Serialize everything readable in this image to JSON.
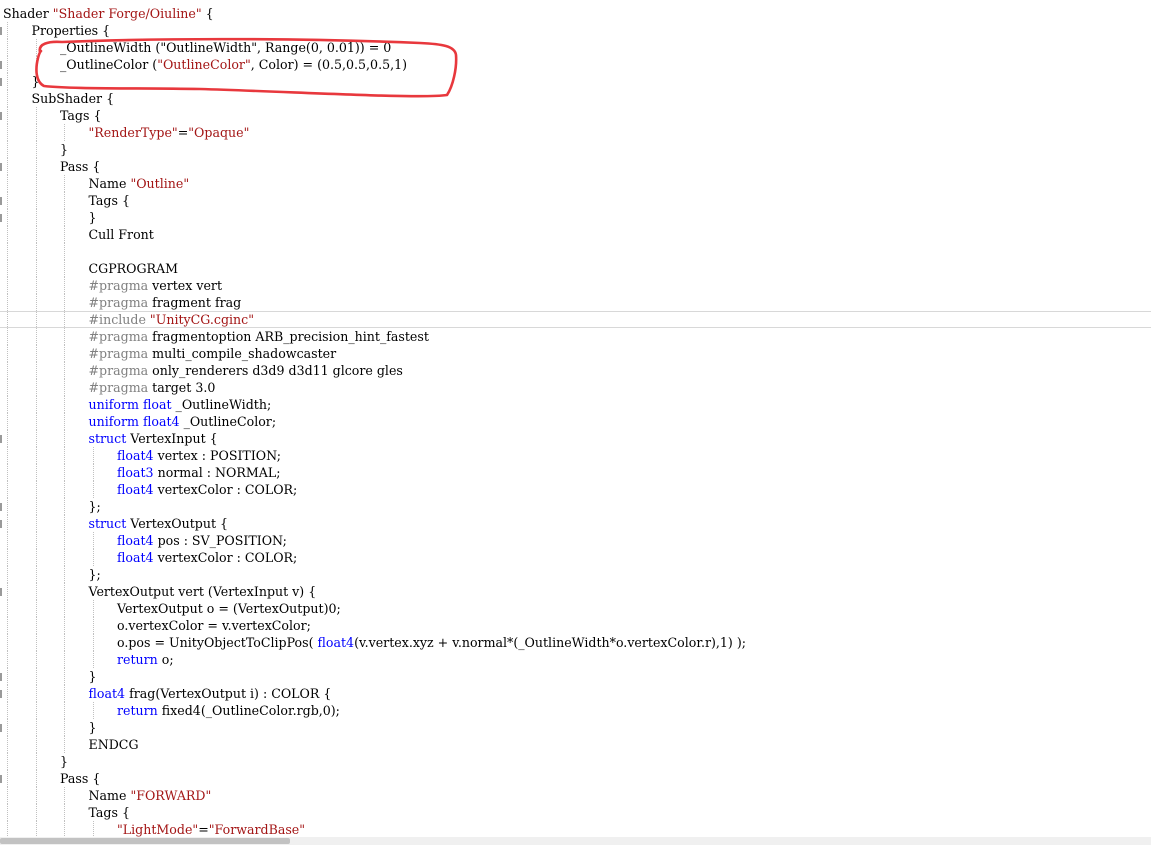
{
  "editor": {
    "current_line": 19,
    "lines": [
      {
        "indent": 0,
        "tokens": [
          [
            "plain",
            "Shader "
          ],
          [
            "str",
            "\"Shader Forge/Oiuline\""
          ],
          [
            "plain",
            " {"
          ]
        ]
      },
      {
        "indent": 1,
        "tokens": [
          [
            "plain",
            "Properties {"
          ]
        ]
      },
      {
        "indent": 2,
        "tokens": [
          [
            "plain",
            "_OutlineWidth (\"OutlineWidth\", Range(0, 0.01)) = 0"
          ]
        ]
      },
      {
        "indent": 2,
        "tokens": [
          [
            "plain",
            "_OutlineColor ("
          ],
          [
            "str",
            "\"OutlineColor\""
          ],
          [
            "plain",
            ", Color) = (0.5,0.5,0.5,1)"
          ]
        ]
      },
      {
        "indent": 1,
        "tokens": [
          [
            "plain",
            "}"
          ]
        ]
      },
      {
        "indent": 1,
        "tokens": [
          [
            "plain",
            "SubShader {"
          ]
        ]
      },
      {
        "indent": 2,
        "tokens": [
          [
            "plain",
            "Tags {"
          ]
        ]
      },
      {
        "indent": 3,
        "tokens": [
          [
            "str",
            "\"RenderType\""
          ],
          [
            "plain",
            "="
          ],
          [
            "str",
            "\"Opaque\""
          ]
        ]
      },
      {
        "indent": 2,
        "tokens": [
          [
            "plain",
            "}"
          ]
        ]
      },
      {
        "indent": 2,
        "tokens": [
          [
            "plain",
            "Pass {"
          ]
        ]
      },
      {
        "indent": 3,
        "tokens": [
          [
            "plain",
            "Name "
          ],
          [
            "str",
            "\"Outline\""
          ]
        ]
      },
      {
        "indent": 3,
        "tokens": [
          [
            "plain",
            "Tags {"
          ]
        ]
      },
      {
        "indent": 3,
        "tokens": [
          [
            "plain",
            "}"
          ]
        ]
      },
      {
        "indent": 3,
        "tokens": [
          [
            "plain",
            "Cull Front"
          ]
        ]
      },
      {
        "indent": 3,
        "tokens": []
      },
      {
        "indent": 3,
        "tokens": [
          [
            "plain",
            "CGPROGRAM"
          ]
        ]
      },
      {
        "indent": 3,
        "tokens": [
          [
            "pp",
            "#pragma"
          ],
          [
            "plain",
            " vertex vert"
          ]
        ]
      },
      {
        "indent": 3,
        "tokens": [
          [
            "pp",
            "#pragma"
          ],
          [
            "plain",
            " fragment frag"
          ]
        ]
      },
      {
        "indent": 3,
        "tokens": [
          [
            "pp",
            "#include"
          ],
          [
            "plain",
            " "
          ],
          [
            "str",
            "\"UnityCG.cginc\""
          ]
        ]
      },
      {
        "indent": 3,
        "tokens": [
          [
            "pp",
            "#pragma"
          ],
          [
            "plain",
            " fragmentoption ARB_precision_hint_fastest"
          ]
        ]
      },
      {
        "indent": 3,
        "tokens": [
          [
            "pp",
            "#pragma"
          ],
          [
            "plain",
            " multi_compile_shadowcaster"
          ]
        ]
      },
      {
        "indent": 3,
        "tokens": [
          [
            "pp",
            "#pragma"
          ],
          [
            "plain",
            " only_renderers d3d9 d3d11 glcore gles"
          ]
        ]
      },
      {
        "indent": 3,
        "tokens": [
          [
            "pp",
            "#pragma"
          ],
          [
            "plain",
            " target 3.0"
          ]
        ]
      },
      {
        "indent": 3,
        "tokens": [
          [
            "kw",
            "uniform"
          ],
          [
            "plain",
            " "
          ],
          [
            "kw",
            "float"
          ],
          [
            "plain",
            " _OutlineWidth;"
          ]
        ]
      },
      {
        "indent": 3,
        "tokens": [
          [
            "kw",
            "uniform"
          ],
          [
            "plain",
            " "
          ],
          [
            "kw",
            "float4"
          ],
          [
            "plain",
            " _OutlineColor;"
          ]
        ]
      },
      {
        "indent": 3,
        "tokens": [
          [
            "kw",
            "struct"
          ],
          [
            "plain",
            " VertexInput {"
          ]
        ]
      },
      {
        "indent": 4,
        "tokens": [
          [
            "kw",
            "float4"
          ],
          [
            "plain",
            " vertex : POSITION;"
          ]
        ]
      },
      {
        "indent": 4,
        "tokens": [
          [
            "kw",
            "float3"
          ],
          [
            "plain",
            " normal : NORMAL;"
          ]
        ]
      },
      {
        "indent": 4,
        "tokens": [
          [
            "kw",
            "float4"
          ],
          [
            "plain",
            " vertexColor : COLOR;"
          ]
        ]
      },
      {
        "indent": 3,
        "tokens": [
          [
            "plain",
            "};"
          ]
        ]
      },
      {
        "indent": 3,
        "tokens": [
          [
            "kw",
            "struct"
          ],
          [
            "plain",
            " VertexOutput {"
          ]
        ]
      },
      {
        "indent": 4,
        "tokens": [
          [
            "kw",
            "float4"
          ],
          [
            "plain",
            " pos : SV_POSITION;"
          ]
        ]
      },
      {
        "indent": 4,
        "tokens": [
          [
            "kw",
            "float4"
          ],
          [
            "plain",
            " vertexColor : COLOR;"
          ]
        ]
      },
      {
        "indent": 3,
        "tokens": [
          [
            "plain",
            "};"
          ]
        ]
      },
      {
        "indent": 3,
        "tokens": [
          [
            "plain",
            "VertexOutput vert (VertexInput v) {"
          ]
        ]
      },
      {
        "indent": 4,
        "tokens": [
          [
            "plain",
            "VertexOutput o = (VertexOutput)0;"
          ]
        ]
      },
      {
        "indent": 4,
        "tokens": [
          [
            "plain",
            "o.vertexColor = v.vertexColor;"
          ]
        ]
      },
      {
        "indent": 4,
        "tokens": [
          [
            "plain",
            "o.pos = UnityObjectToClipPos( "
          ],
          [
            "kw",
            "float4"
          ],
          [
            "plain",
            "(v.vertex.xyz + v.normal*(_OutlineWidth*o.vertexColor.r),1) );"
          ]
        ]
      },
      {
        "indent": 4,
        "tokens": [
          [
            "kw",
            "return"
          ],
          [
            "plain",
            " o;"
          ]
        ]
      },
      {
        "indent": 3,
        "tokens": [
          [
            "plain",
            "}"
          ]
        ]
      },
      {
        "indent": 3,
        "tokens": [
          [
            "kw",
            "float4"
          ],
          [
            "plain",
            " frag(VertexOutput i) : COLOR {"
          ]
        ]
      },
      {
        "indent": 4,
        "tokens": [
          [
            "kw",
            "return"
          ],
          [
            "plain",
            " fixed4(_OutlineColor.rgb,0);"
          ]
        ]
      },
      {
        "indent": 3,
        "tokens": [
          [
            "plain",
            "}"
          ]
        ]
      },
      {
        "indent": 3,
        "tokens": [
          [
            "plain",
            "ENDCG"
          ]
        ]
      },
      {
        "indent": 2,
        "tokens": [
          [
            "plain",
            "}"
          ]
        ]
      },
      {
        "indent": 2,
        "tokens": [
          [
            "plain",
            "Pass {"
          ]
        ]
      },
      {
        "indent": 3,
        "tokens": [
          [
            "plain",
            "Name "
          ],
          [
            "str",
            "\"FORWARD\""
          ]
        ]
      },
      {
        "indent": 3,
        "tokens": [
          [
            "plain",
            "Tags {"
          ]
        ]
      },
      {
        "indent": 4,
        "tokens": [
          [
            "str",
            "\"LightMode\""
          ],
          [
            "plain",
            "="
          ],
          [
            "str",
            "\"ForwardBase\""
          ]
        ]
      }
    ]
  },
  "colors": {
    "string": "#a31515",
    "keyword": "#0000ff",
    "preprocessor": "#808080",
    "annotation": "#e8383d"
  }
}
